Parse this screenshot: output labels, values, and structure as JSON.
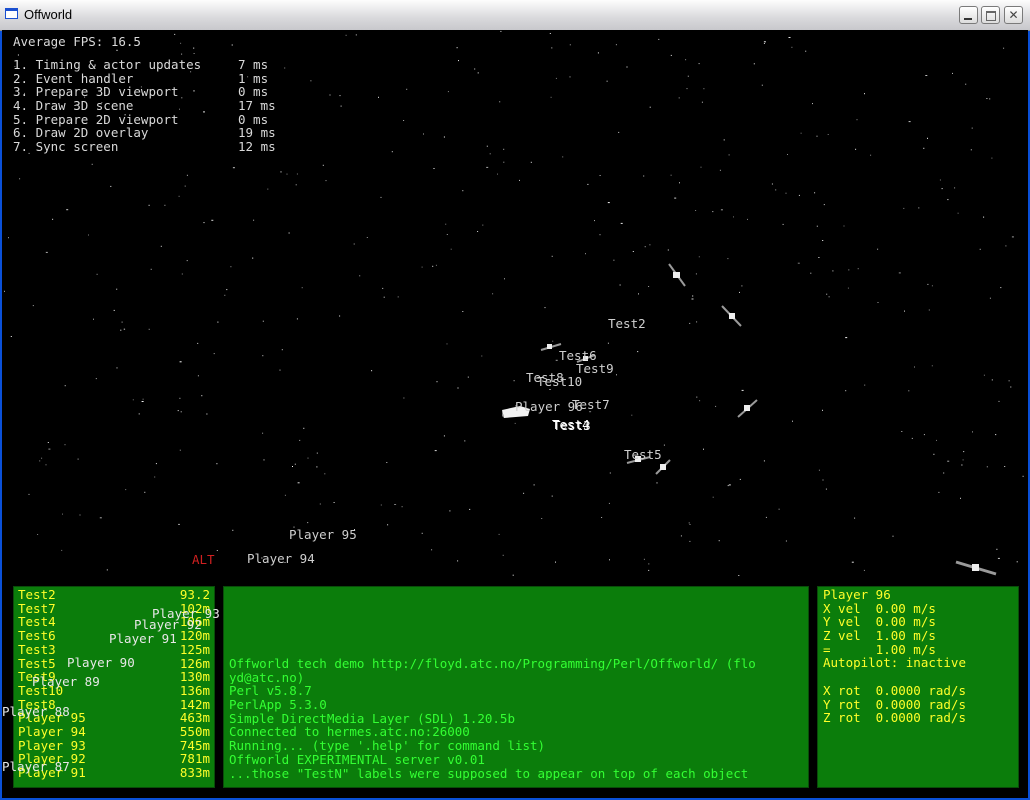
{
  "window": {
    "title": "Offworld"
  },
  "hud": {
    "fps": "Average FPS: 16.5",
    "timings": [
      {
        "label": "1. Timing & actor updates",
        "value": "7 ms"
      },
      {
        "label": "2. Event handler",
        "value": "1 ms"
      },
      {
        "label": "3. Prepare 3D viewport",
        "value": "0 ms"
      },
      {
        "label": "4. Draw 3D scene",
        "value": "17 ms"
      },
      {
        "label": "5. Prepare 2D viewport",
        "value": "0 ms"
      },
      {
        "label": "6. Draw 2D overlay",
        "value": "19 ms"
      },
      {
        "label": "7. Sync screen",
        "value": "12 ms"
      }
    ],
    "alt": "ALT"
  },
  "scene_labels": [
    "Test2",
    "Test6",
    "Test9",
    "Test8",
    "Test10",
    "Player 96",
    "Test7",
    "Test4",
    "Test3",
    "Test5",
    "Player 95",
    "Player 94"
  ],
  "overlay_labels": [
    "Player 93",
    "Player 92",
    "Player 91",
    "Player 90",
    "Player 89",
    "Player 88",
    "Player 87"
  ],
  "targets": [
    {
      "name": "Test2",
      "dist": "93.2"
    },
    {
      "name": "Test7",
      "dist": "102m"
    },
    {
      "name": "Test4",
      "dist": "106m"
    },
    {
      "name": "Test6",
      "dist": "120m"
    },
    {
      "name": "Test3",
      "dist": "125m"
    },
    {
      "name": "Test5",
      "dist": "126m"
    },
    {
      "name": "Test9",
      "dist": "130m"
    },
    {
      "name": "Test10",
      "dist": "136m"
    },
    {
      "name": "Test8",
      "dist": "142m"
    },
    {
      "name": "Player 95",
      "dist": "463m"
    },
    {
      "name": "Player 94",
      "dist": "550m"
    },
    {
      "name": "Player 93",
      "dist": "745m"
    },
    {
      "name": "Player 92",
      "dist": "781m"
    },
    {
      "name": "Player 91",
      "dist": "833m"
    }
  ],
  "console": [
    "Offworld tech demo http://floyd.atc.no/Programming/Perl/Offworld/ (flo",
    "yd@atc.no)",
    "Perl v5.8.7",
    "PerlApp 5.3.0",
    "Simple DirectMedia Layer (SDL) 1.20.5b",
    "Connected to hermes.atc.no:26000",
    "Running... (type '.help' for command list)",
    "Offworld EXPERIMENTAL server v0.01",
    "...those \"TestN\" labels were supposed to appear on top of each object_"
  ],
  "status": {
    "player": "Player 96",
    "lines": [
      "X vel  0.00 m/s",
      "Y vel  0.00 m/s",
      "Z vel  1.00 m/s",
      "=      1.00 m/s",
      "Autopilot: inactive",
      "",
      "X rot  0.0000 rad/s",
      "Y rot  0.0000 rad/s",
      "Z rot  0.0000 rad/s"
    ]
  }
}
